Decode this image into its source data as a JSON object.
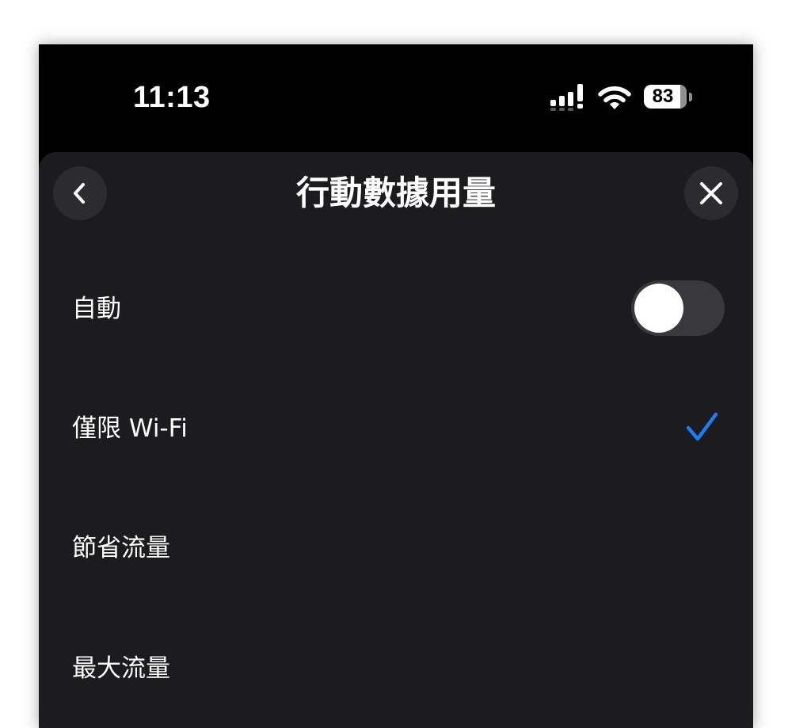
{
  "status_bar": {
    "time": "11:13",
    "battery_percent": "83",
    "icons": [
      "signal-bars-icon",
      "wifi-icon",
      "battery-icon"
    ]
  },
  "sheet": {
    "title": "行動數據用量",
    "back_icon": "chevron-left-icon",
    "close_icon": "close-icon",
    "options": [
      {
        "label": "自動",
        "control": "toggle",
        "toggle_on": false
      },
      {
        "label": "僅限 Wi-Fi",
        "control": "checkmark",
        "selected": true
      },
      {
        "label": "節省流量",
        "control": "none",
        "selected": false
      },
      {
        "label": "最大流量",
        "control": "none",
        "selected": false
      }
    ]
  },
  "colors": {
    "background": "#000000",
    "sheet": "#1c1c1e",
    "button": "#2c2c2e",
    "toggle_off": "#39393d",
    "accent_blue": "#1e7cf2",
    "text": "#ffffff"
  }
}
